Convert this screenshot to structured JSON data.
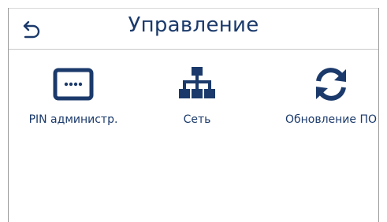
{
  "header": {
    "title": "Управление",
    "back_icon": "back-arrow-icon"
  },
  "tiles": [
    {
      "label": "PIN администр.",
      "icon": "pin-keypad-icon"
    },
    {
      "label": "Сеть",
      "icon": "network-icon"
    },
    {
      "label": "Обновление ПО",
      "icon": "refresh-icon"
    }
  ],
  "colors": {
    "accent": "#1b3a6b",
    "divider": "#c8c8c8",
    "background": "#ffffff"
  }
}
